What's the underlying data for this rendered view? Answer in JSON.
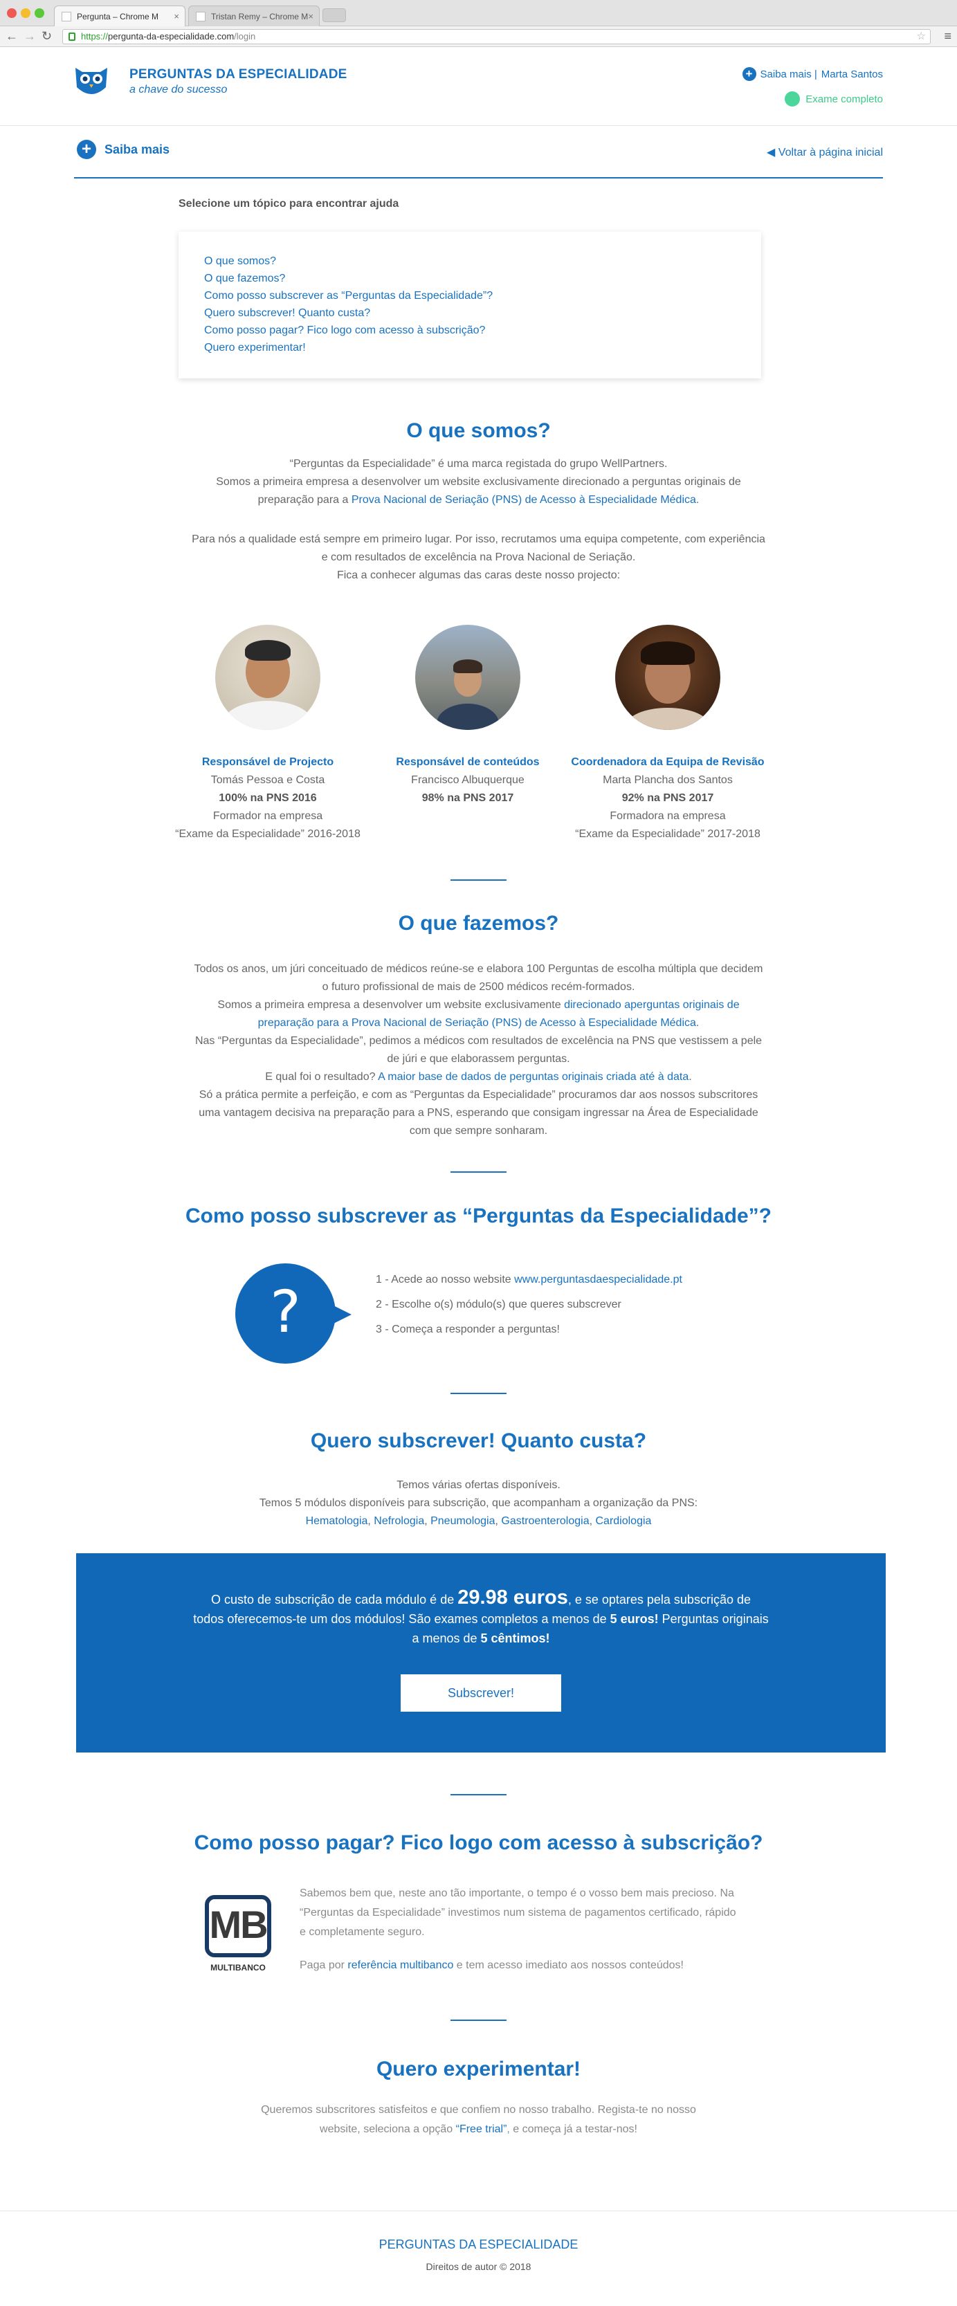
{
  "browser": {
    "tabs": [
      {
        "label": "Pergunta – Chrome M"
      },
      {
        "label": "Tristan Remy – Chrome M"
      }
    ],
    "url": {
      "scheme": "https://",
      "host": "pergunta-da-especialidade.com",
      "path": "/login"
    }
  },
  "header": {
    "brand_name": "PERGUNTAS DA ESPECIALIDADE",
    "tagline": "a chave do sucesso",
    "saiba_mais": "Saiba mais |",
    "user_name": "Marta Santos",
    "status": "Exame completo",
    "status_color": "#4cd69a",
    "accent": "#1872c0"
  },
  "subnav": {
    "saiba_mais": "Saiba mais",
    "back_link": "◀  Voltar à página inicial"
  },
  "topics": {
    "heading": "Selecione um tópico para encontrar ajuda",
    "items": [
      "O que somos?",
      "O que fazemos?",
      "Como posso subscrever as “Perguntas da Especialidade”?",
      "Quero subscrever! Quanto custa?",
      "Como posso pagar? Fico logo com acesso à subscrição?",
      "Quero experimentar!"
    ]
  },
  "about": {
    "title": "O que somos?",
    "p1_line1": "“Perguntas da Especialidade” é uma marca registada do grupo WellPartners.",
    "p1_line2": "Somos a primeira empresa a desenvolver um website exclusivamente direcionado a perguntas originais de",
    "p1_line3_pre": "preparação para a ",
    "p1_line3_link": "Prova Nacional de Seriação (PNS) de Acesso à Especialidade Médica",
    "p1_line3_post": ".",
    "p2_line1": "Para nós a qualidade está sempre em primeiro lugar. Por isso, recrutamos uma equipa competente, com experiência",
    "p2_line2": "e com resultados de excelência na Prova Nacional de Seriação.",
    "p2_line3": "Fica a conhecer algumas das caras deste nosso projecto:",
    "team": [
      {
        "role": "Responsável de Projecto",
        "name": "Tomás Pessoa e Costa",
        "score": "100% na PNS 2016",
        "extra1": "Formador na empresa",
        "extra2": "“Exame da Especialidade” 2016-2018"
      },
      {
        "role": "Responsável de conteúdos",
        "name": "Francisco Albuquerque",
        "score": "98% na PNS 2017",
        "extra1": "",
        "extra2": ""
      },
      {
        "role": "Coordenadora da Equipa de Revisão",
        "name": "Marta Plancha dos Santos",
        "score": "92% na PNS 2017",
        "extra1": "Formadora na empresa",
        "extra2": "“Exame da Especialidade” 2017-2018"
      }
    ]
  },
  "what": {
    "title": "O que fazemos?",
    "l1": "Todos os anos, um júri conceituado de médicos reúne-se e elabora 100 Perguntas de escolha múltipla que decidem",
    "l2": "o futuro profissional de mais de 2500 médicos recém-formados.",
    "l3_pre": "Somos a primeira empresa a desenvolver um website exclusivamente ",
    "l3_link": "direcionado aperguntas originais de",
    "l4_link": "preparação para a Prova Nacional de Seriação (PNS) de Acesso à Especialidade Médica",
    "l4_post": ".",
    "l5": "Nas “Perguntas da Especialidade”, pedimos a médicos com resultados de excelência na PNS que vestissem a pele",
    "l6": "de júri e que elaborassem perguntas.",
    "l7_pre": "E qual foi o resultado? ",
    "l7_link": "A maior base de dados de perguntas originais criada até à data",
    "l7_post": ".",
    "l8": "Só a prática permite a perfeição, e com as “Perguntas da Especialidade” procuramos dar aos nossos subscritores",
    "l9": "uma vantagem decisiva na preparação para a PNS, esperando que consigam ingressar na Área de Especialidade",
    "l10": "com que sempre sonharam."
  },
  "subscribe": {
    "title": "Como posso subscrever as “Perguntas da Especialidade”?",
    "bubble_glyph": "?",
    "step1_pre": "1 - Acede ao nosso website ",
    "step1_link": "www.perguntasdaespecialidade.pt",
    "step2": "2 - Escolhe o(s) módulo(s) que queres subscrever",
    "step3": "3 - Começa a responder a perguntas!"
  },
  "pricing": {
    "title": "Quero subscrever! Quanto custa?",
    "l1": "Temos várias ofertas disponíveis.",
    "l2": "Temos 5 módulos disponíveis para subscrição, que acompanham a organização da PNS:",
    "modules": [
      "Hematologia",
      "Nefrologia",
      "Pneumologia",
      "Gastroenterologia",
      "Cardiologia"
    ],
    "band_pre": "O custo de subscrição de cada módulo é de ",
    "band_price": "29.98 euros",
    "band_mid": ", e se optares pela subscrição de",
    "band_l2_pre": "todos oferecemos-te um dos módulos! São exames completos a menos de ",
    "band_l2_bold": "5 euros!",
    "band_l2_post": " Perguntas originais",
    "band_l3_pre": "a menos de ",
    "band_l3_bold": "5 cêntimos!",
    "button": "Subscrever!",
    "band_color": "#1168b6"
  },
  "payment": {
    "title": "Como posso pagar? Fico logo com acesso à subscrição?",
    "logo_letters": "MB",
    "logo_word": "MULTIBANCO",
    "p1_l1": "Sabemos bem que, neste ano tão importante, o tempo é o vosso bem mais precioso. Na",
    "p1_l2": "“Perguntas da Especialidade” investimos num sistema de pagamentos certificado, rápido",
    "p1_l3": "e completamente seguro.",
    "p2_pre": "Paga por ",
    "p2_link": "referência multibanco",
    "p2_post": " e tem acesso imediato aos nossos conteúdos!"
  },
  "trial": {
    "title": "Quero experimentar!",
    "l1": "Queremos subscritores satisfeitos e que confiem no nosso trabalho. Regista-te no nosso",
    "l2_pre": "website, seleciona a opção ",
    "l2_link": "“Free trial”",
    "l2_post": ", e começa já a testar-nos!"
  },
  "footer": {
    "brand": "PERGUNTAS DA ESPECIALIDADE",
    "copyright": "Direitos de autor © 2018"
  }
}
